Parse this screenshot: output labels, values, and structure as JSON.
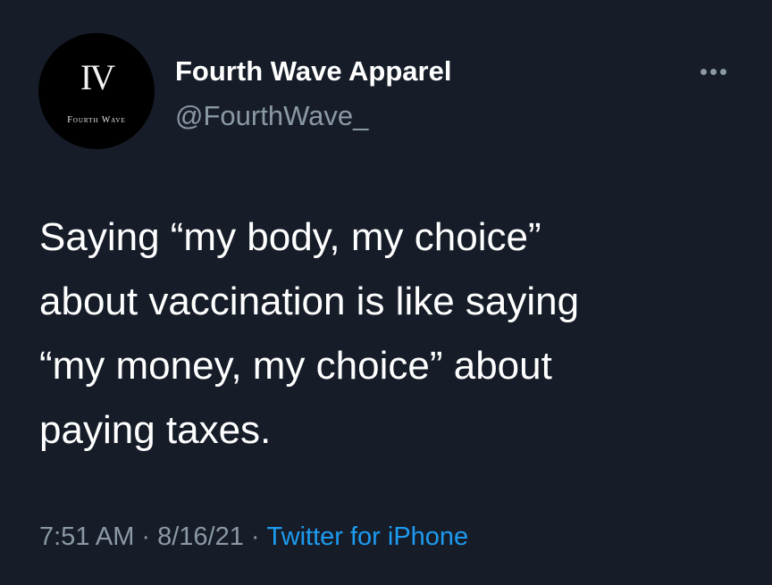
{
  "tweet": {
    "author": {
      "display_name": "Fourth Wave Apparel",
      "handle": "@FourthWave_",
      "avatar_mark": "IV",
      "avatar_text": "Fourth Wave"
    },
    "more_icon": "more-horizontal-icon",
    "text": "Saying “my body, my choice”\nabout vaccination is like saying\n“my money, my choice” about\npaying taxes.",
    "time": "7:51 AM",
    "separator": "·",
    "date": "8/16/21",
    "source": "Twitter for iPhone"
  },
  "colors": {
    "background": "#161d29",
    "primary_text": "#ffffff",
    "secondary_text": "#8b98a5",
    "link": "#1d9bf0"
  }
}
